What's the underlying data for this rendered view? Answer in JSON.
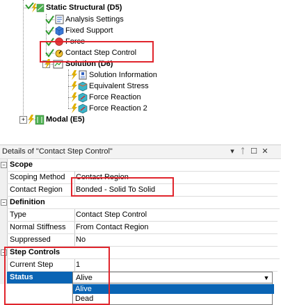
{
  "tree": {
    "static_structural": "Static Structural (D5)",
    "analysis_settings": "Analysis Settings",
    "fixed_support": "Fixed Support",
    "force": "Force",
    "contact_step_control": "Contact Step Control",
    "solution": "Solution (D6)",
    "solution_information": "Solution Information",
    "equivalent_stress": "Equivalent Stress",
    "force_reaction": "Force Reaction",
    "force_reaction_2": "Force Reaction 2",
    "modal": "Modal (E5)",
    "expander_plus": "+",
    "expander_minus": "−"
  },
  "details": {
    "title": "Details of \"Contact Step Control\"",
    "header_buttons": {
      "dropdown": "▾",
      "pin": "ᛏ",
      "restore": "☐",
      "close": "✕"
    },
    "sections": {
      "scope": "Scope",
      "definition": "Definition",
      "step_controls": "Step Controls"
    },
    "rows": {
      "scoping_method": {
        "name": "Scoping Method",
        "value": "Contact Region"
      },
      "contact_region": {
        "name": "Contact Region",
        "value": "Bonded - Solid To Solid"
      },
      "type": {
        "name": "Type",
        "value": "Contact Step Control"
      },
      "normal_stiffness": {
        "name": "Normal Stiffness",
        "value": "From Contact Region"
      },
      "suppressed": {
        "name": "Suppressed",
        "value": "No"
      },
      "current_step": {
        "name": "Current Step",
        "value": "1"
      },
      "status": {
        "name": "Status",
        "value": "Alive"
      }
    },
    "status_options": [
      "Alive",
      "Dead"
    ],
    "minus": "−",
    "dropdown_arrow": "▼"
  },
  "colors": {
    "selection": "#0a64b4",
    "annotation": "#e0242c",
    "check": "#2e9a2e",
    "bolt": "#e0b000"
  }
}
